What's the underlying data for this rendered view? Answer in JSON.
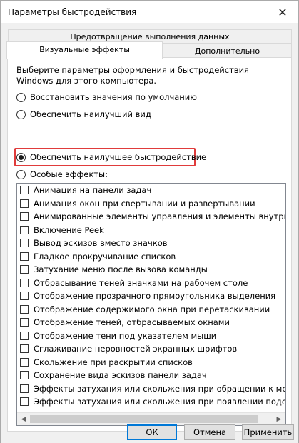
{
  "window": {
    "title": "Параметры быстродействия",
    "close_glyph": "✕"
  },
  "tabs": {
    "data_execution": "Предотвращение выполнения данных",
    "visual_effects": "Визуальные эффекты",
    "advanced": "Дополнительно"
  },
  "panel": {
    "description": "Выберите параметры оформления и быстродействия Windows для этого компьютера.",
    "radios": [
      {
        "label": "Восстановить значения по умолчанию",
        "checked": false
      },
      {
        "label": "Обеспечить наилучший вид",
        "checked": false
      },
      {
        "label": "Обеспечить наилучшее быстродействие",
        "checked": true
      },
      {
        "label": "Особые эффекты:",
        "checked": false
      }
    ],
    "effects": [
      "Анимация на панели задач",
      "Анимация окон при свертывании и развертывании",
      "Анимированные элементы управления и элементы внутри окн",
      "Включение Peek",
      "Вывод эскизов вместо значков",
      "Гладкое прокручивание списков",
      "Затухание меню после вызова команды",
      "Отбрасывание теней значками на рабочем столе",
      "Отображение прозрачного прямоугольника выделения",
      "Отображение содержимого окна при перетаскивании",
      "Отображение теней, отбрасываемых окнами",
      "Отображение тени под указателем мыши",
      "Сглаживание неровностей экранных шрифтов",
      "Скольжение при раскрытии списков",
      "Сохранение вида эскизов панели задач",
      "Эффекты затухания или скольжения при обращении к меню",
      "Эффекты затухания или скольжения при появлении подсказок"
    ],
    "scroll_left_glyph": "◀",
    "scroll_right_glyph": "▶"
  },
  "buttons": {
    "ok": "ОК",
    "cancel": "Отмена",
    "apply": "Применить"
  },
  "colors": {
    "highlight": "#e03b3b",
    "default_button_border": "#0078d7"
  }
}
